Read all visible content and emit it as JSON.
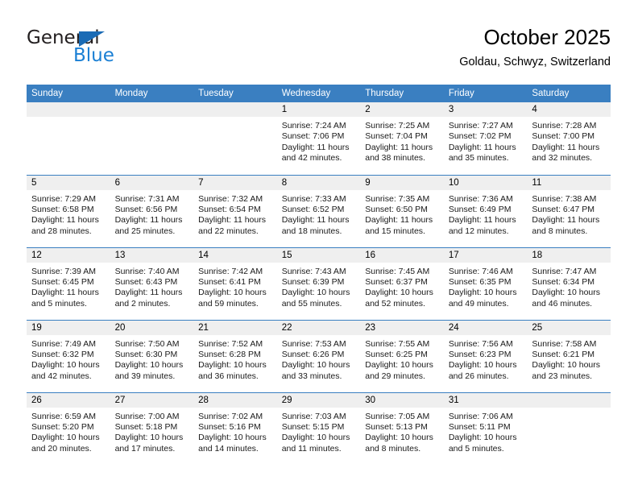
{
  "brand": {
    "name_part1": "General",
    "name_part2": "Blue",
    "triangle_color": "#1a6bb5",
    "blue_color": "#1a7fd4"
  },
  "header": {
    "title": "October 2025",
    "subtitle": "Goldau, Schwyz, Switzerland",
    "accent_color": "#3a7fc1"
  },
  "calendar": {
    "weekday_headers": [
      "Sunday",
      "Monday",
      "Tuesday",
      "Wednesday",
      "Thursday",
      "Friday",
      "Saturday"
    ],
    "weeks": [
      [
        {
          "empty": true
        },
        {
          "empty": true
        },
        {
          "empty": true
        },
        {
          "day": "1",
          "sunrise": "Sunrise: 7:24 AM",
          "sunset": "Sunset: 7:06 PM",
          "daylight_line1": "Daylight: 11 hours",
          "daylight_line2": "and 42 minutes."
        },
        {
          "day": "2",
          "sunrise": "Sunrise: 7:25 AM",
          "sunset": "Sunset: 7:04 PM",
          "daylight_line1": "Daylight: 11 hours",
          "daylight_line2": "and 38 minutes."
        },
        {
          "day": "3",
          "sunrise": "Sunrise: 7:27 AM",
          "sunset": "Sunset: 7:02 PM",
          "daylight_line1": "Daylight: 11 hours",
          "daylight_line2": "and 35 minutes."
        },
        {
          "day": "4",
          "sunrise": "Sunrise: 7:28 AM",
          "sunset": "Sunset: 7:00 PM",
          "daylight_line1": "Daylight: 11 hours",
          "daylight_line2": "and 32 minutes."
        }
      ],
      [
        {
          "day": "5",
          "sunrise": "Sunrise: 7:29 AM",
          "sunset": "Sunset: 6:58 PM",
          "daylight_line1": "Daylight: 11 hours",
          "daylight_line2": "and 28 minutes."
        },
        {
          "day": "6",
          "sunrise": "Sunrise: 7:31 AM",
          "sunset": "Sunset: 6:56 PM",
          "daylight_line1": "Daylight: 11 hours",
          "daylight_line2": "and 25 minutes."
        },
        {
          "day": "7",
          "sunrise": "Sunrise: 7:32 AM",
          "sunset": "Sunset: 6:54 PM",
          "daylight_line1": "Daylight: 11 hours",
          "daylight_line2": "and 22 minutes."
        },
        {
          "day": "8",
          "sunrise": "Sunrise: 7:33 AM",
          "sunset": "Sunset: 6:52 PM",
          "daylight_line1": "Daylight: 11 hours",
          "daylight_line2": "and 18 minutes."
        },
        {
          "day": "9",
          "sunrise": "Sunrise: 7:35 AM",
          "sunset": "Sunset: 6:50 PM",
          "daylight_line1": "Daylight: 11 hours",
          "daylight_line2": "and 15 minutes."
        },
        {
          "day": "10",
          "sunrise": "Sunrise: 7:36 AM",
          "sunset": "Sunset: 6:49 PM",
          "daylight_line1": "Daylight: 11 hours",
          "daylight_line2": "and 12 minutes."
        },
        {
          "day": "11",
          "sunrise": "Sunrise: 7:38 AM",
          "sunset": "Sunset: 6:47 PM",
          "daylight_line1": "Daylight: 11 hours",
          "daylight_line2": "and 8 minutes."
        }
      ],
      [
        {
          "day": "12",
          "sunrise": "Sunrise: 7:39 AM",
          "sunset": "Sunset: 6:45 PM",
          "daylight_line1": "Daylight: 11 hours",
          "daylight_line2": "and 5 minutes."
        },
        {
          "day": "13",
          "sunrise": "Sunrise: 7:40 AM",
          "sunset": "Sunset: 6:43 PM",
          "daylight_line1": "Daylight: 11 hours",
          "daylight_line2": "and 2 minutes."
        },
        {
          "day": "14",
          "sunrise": "Sunrise: 7:42 AM",
          "sunset": "Sunset: 6:41 PM",
          "daylight_line1": "Daylight: 10 hours",
          "daylight_line2": "and 59 minutes."
        },
        {
          "day": "15",
          "sunrise": "Sunrise: 7:43 AM",
          "sunset": "Sunset: 6:39 PM",
          "daylight_line1": "Daylight: 10 hours",
          "daylight_line2": "and 55 minutes."
        },
        {
          "day": "16",
          "sunrise": "Sunrise: 7:45 AM",
          "sunset": "Sunset: 6:37 PM",
          "daylight_line1": "Daylight: 10 hours",
          "daylight_line2": "and 52 minutes."
        },
        {
          "day": "17",
          "sunrise": "Sunrise: 7:46 AM",
          "sunset": "Sunset: 6:35 PM",
          "daylight_line1": "Daylight: 10 hours",
          "daylight_line2": "and 49 minutes."
        },
        {
          "day": "18",
          "sunrise": "Sunrise: 7:47 AM",
          "sunset": "Sunset: 6:34 PM",
          "daylight_line1": "Daylight: 10 hours",
          "daylight_line2": "and 46 minutes."
        }
      ],
      [
        {
          "day": "19",
          "sunrise": "Sunrise: 7:49 AM",
          "sunset": "Sunset: 6:32 PM",
          "daylight_line1": "Daylight: 10 hours",
          "daylight_line2": "and 42 minutes."
        },
        {
          "day": "20",
          "sunrise": "Sunrise: 7:50 AM",
          "sunset": "Sunset: 6:30 PM",
          "daylight_line1": "Daylight: 10 hours",
          "daylight_line2": "and 39 minutes."
        },
        {
          "day": "21",
          "sunrise": "Sunrise: 7:52 AM",
          "sunset": "Sunset: 6:28 PM",
          "daylight_line1": "Daylight: 10 hours",
          "daylight_line2": "and 36 minutes."
        },
        {
          "day": "22",
          "sunrise": "Sunrise: 7:53 AM",
          "sunset": "Sunset: 6:26 PM",
          "daylight_line1": "Daylight: 10 hours",
          "daylight_line2": "and 33 minutes."
        },
        {
          "day": "23",
          "sunrise": "Sunrise: 7:55 AM",
          "sunset": "Sunset: 6:25 PM",
          "daylight_line1": "Daylight: 10 hours",
          "daylight_line2": "and 29 minutes."
        },
        {
          "day": "24",
          "sunrise": "Sunrise: 7:56 AM",
          "sunset": "Sunset: 6:23 PM",
          "daylight_line1": "Daylight: 10 hours",
          "daylight_line2": "and 26 minutes."
        },
        {
          "day": "25",
          "sunrise": "Sunrise: 7:58 AM",
          "sunset": "Sunset: 6:21 PM",
          "daylight_line1": "Daylight: 10 hours",
          "daylight_line2": "and 23 minutes."
        }
      ],
      [
        {
          "day": "26",
          "sunrise": "Sunrise: 6:59 AM",
          "sunset": "Sunset: 5:20 PM",
          "daylight_line1": "Daylight: 10 hours",
          "daylight_line2": "and 20 minutes."
        },
        {
          "day": "27",
          "sunrise": "Sunrise: 7:00 AM",
          "sunset": "Sunset: 5:18 PM",
          "daylight_line1": "Daylight: 10 hours",
          "daylight_line2": "and 17 minutes."
        },
        {
          "day": "28",
          "sunrise": "Sunrise: 7:02 AM",
          "sunset": "Sunset: 5:16 PM",
          "daylight_line1": "Daylight: 10 hours",
          "daylight_line2": "and 14 minutes."
        },
        {
          "day": "29",
          "sunrise": "Sunrise: 7:03 AM",
          "sunset": "Sunset: 5:15 PM",
          "daylight_line1": "Daylight: 10 hours",
          "daylight_line2": "and 11 minutes."
        },
        {
          "day": "30",
          "sunrise": "Sunrise: 7:05 AM",
          "sunset": "Sunset: 5:13 PM",
          "daylight_line1": "Daylight: 10 hours",
          "daylight_line2": "and 8 minutes."
        },
        {
          "day": "31",
          "sunrise": "Sunrise: 7:06 AM",
          "sunset": "Sunset: 5:11 PM",
          "daylight_line1": "Daylight: 10 hours",
          "daylight_line2": "and 5 minutes."
        },
        {
          "empty": true
        }
      ]
    ]
  }
}
